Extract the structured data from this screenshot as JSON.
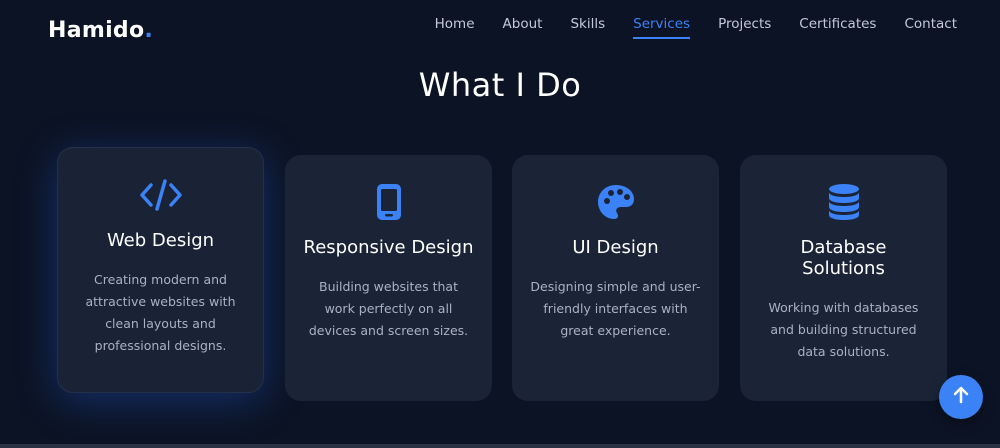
{
  "brand": {
    "name": "Hamido",
    "dot": "."
  },
  "nav": {
    "items": [
      "Home",
      "About",
      "Skills",
      "Services",
      "Projects",
      "Certificates",
      "Contact"
    ],
    "active": "Services"
  },
  "section": {
    "title": "What I Do"
  },
  "services": [
    {
      "icon": "code-icon",
      "title": "Web Design",
      "description": "Creating modern and attractive websites with clean layouts and professional designs."
    },
    {
      "icon": "mobile-icon",
      "title": "Responsive Design",
      "description": "Building websites that work perfectly on all devices and screen sizes."
    },
    {
      "icon": "palette-icon",
      "title": "UI Design",
      "description": "Designing simple and user-friendly interfaces with great experience."
    },
    {
      "icon": "database-icon",
      "title": "Database Solutions",
      "description": "Working with databases and building structured data solutions."
    }
  ],
  "scroll_top": {
    "icon": "arrow-up-icon"
  },
  "colors": {
    "accent": "#3b82f6",
    "background": "#0c1324",
    "card": "#1b2436"
  }
}
